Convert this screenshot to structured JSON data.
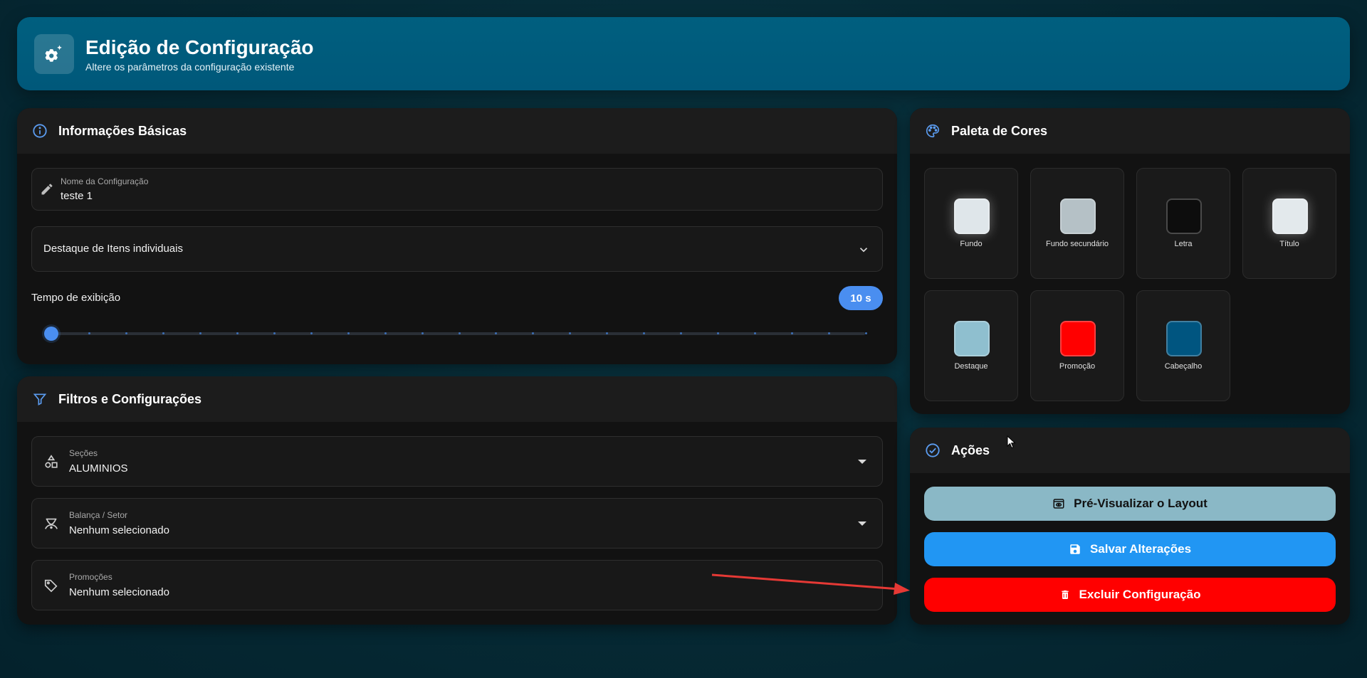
{
  "header": {
    "title": "Edição de Configuração",
    "subtitle": "Altere os parâmetros da configuração existente",
    "icon": "gear-sparkle-icon"
  },
  "basic_info": {
    "title": "Informações Básicas",
    "icon": "info-icon",
    "name_field": {
      "label": "Nome da Configuração",
      "value": "teste 1",
      "icon": "pencil-icon"
    },
    "highlight_select": {
      "value": "Destaque de Itens individuais"
    },
    "time": {
      "label": "Tempo de exibição",
      "badge": "10 s",
      "slider_fraction": 0.0
    }
  },
  "filters": {
    "title": "Filtros e Configurações",
    "icon": "filter-icon",
    "sections": {
      "label": "Seções",
      "value": "ALUMINIOS",
      "icon": "shapes-icon"
    },
    "scale": {
      "label": "Balança / Setor",
      "value": "Nenhum selecionado",
      "icon": "scale-icon"
    },
    "promotions": {
      "label": "Promoções",
      "value": "Nenhum selecionado",
      "icon": "tag-icon"
    }
  },
  "palette": {
    "title": "Paleta de Cores",
    "icon": "palette-icon",
    "colors": [
      {
        "label": "Fundo",
        "color": "#dfe6ea"
      },
      {
        "label": "Fundo secundário",
        "color": "#b5c1c6"
      },
      {
        "label": "Letra",
        "color": "#0d0d0d"
      },
      {
        "label": "Título",
        "color": "#e3e9ec"
      },
      {
        "label": "Destaque",
        "color": "#8fbfcf"
      },
      {
        "label": "Promoção",
        "color": "#ff0000"
      },
      {
        "label": "Cabeçalho",
        "color": "#005580"
      }
    ]
  },
  "actions": {
    "title": "Ações",
    "icon": "check-circle-icon",
    "preview": {
      "label": "Pré-Visualizar o Layout",
      "color": "#8ab8c6",
      "icon": "preview-icon"
    },
    "save": {
      "label": "Salvar Alterações",
      "color": "#2196f3",
      "icon": "floppy-icon"
    },
    "delete": {
      "label": "Excluir Configuração",
      "color": "#ff0000",
      "icon": "trash-icon"
    }
  }
}
